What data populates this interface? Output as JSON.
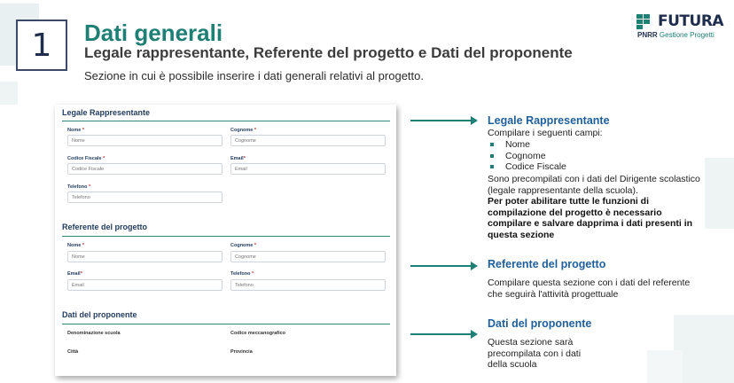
{
  "slide": {
    "number": "1",
    "title": "Dati generali",
    "subtitle": "Legale rappresentante, Referente del progetto e Dati del proponente",
    "description": "Sezione in cui è possibile inserire i dati generali relativi al progetto."
  },
  "logo": {
    "name": "FUTURA",
    "sub_brand": "PNRR",
    "sub_text": "Gestione Progetti"
  },
  "form": {
    "legale": {
      "title": "Legale Rappresentante",
      "nome_label": "Nome",
      "nome_placeholder": "Nome",
      "cognome_label": "Cognome",
      "cognome_placeholder": "Cognome",
      "cf_label": "Codice Fiscale",
      "cf_placeholder": "Codice Fiscale",
      "email_label": "Email",
      "email_placeholder": "Email",
      "tel_label": "Telefono",
      "tel_placeholder": "Telefono"
    },
    "referente": {
      "title": "Referente del progetto",
      "nome_label": "Nome",
      "nome_placeholder": "Nome",
      "cognome_label": "Cognome",
      "cognome_placeholder": "Cognome",
      "email_label": "Email",
      "email_placeholder": "Email",
      "tel_label": "Telefono",
      "tel_placeholder": "Telefono"
    },
    "proponente": {
      "title": "Dati del proponente",
      "denominazione_label": "Denominazione scuola",
      "codice_label": "Codice meccanografico",
      "citta_label": "Città",
      "provincia_label": "Provincia"
    },
    "required_mark": "*"
  },
  "explanations": {
    "legale": {
      "heading": "Legale Rappresentante",
      "intro": "Compilare i seguenti campi:",
      "items": [
        "Nome",
        "Cognome",
        "Codice Fiscale"
      ],
      "note": "Sono precompilati con i dati del Dirigente scolastico (legale rappresentante della scuola).",
      "bold_note": "Per poter abilitare tutte le funzioni di compilazione del progetto è necessario compilare e salvare dapprima i dati presenti in questa sezione"
    },
    "referente": {
      "heading": "Referente del progetto",
      "text": "Compilare questa sezione con i dati del referente che seguirà l'attività progettuale"
    },
    "proponente": {
      "heading": "Dati del proponente",
      "text": "Questa sezione sarà precompilata con i dati della scuola"
    }
  },
  "colors": {
    "accent": "#1e7f74",
    "heading_blue": "#1f5f9a",
    "navy": "#1f2d4d"
  }
}
